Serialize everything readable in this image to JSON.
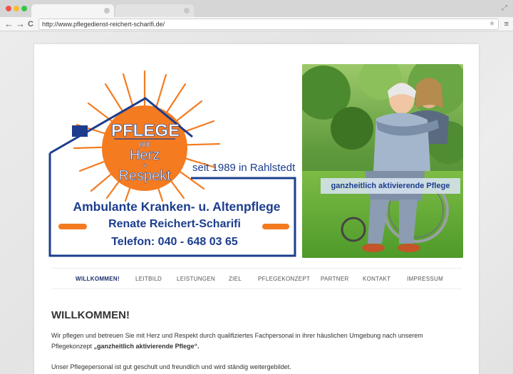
{
  "browser": {
    "url": "http://www.pflegedienst-reichert-scharifi.de/",
    "back_glyph": "←",
    "forward_glyph": "→",
    "reload_glyph": "C",
    "star_glyph": "★",
    "menu_glyph": "≡",
    "resize_glyph": "⤢"
  },
  "logo": {
    "pflege": "PFLEGE",
    "mit": "mit",
    "herz": "Herz",
    "plus": "+",
    "respekt": "Respekt",
    "since": "seit 1989 in Rahlstedt",
    "service": "Ambulante Kranken- u. Altenpflege",
    "owner": "Renate Reichert-Scharifi",
    "phone": "Telefon: 040 - 648 03 65"
  },
  "photo": {
    "caption": "ganzheitlich aktivierende Pflege"
  },
  "nav": {
    "items": [
      {
        "label": "WILLKOMMEN!",
        "active": true
      },
      {
        "label": "LEITBILD",
        "active": false
      },
      {
        "label": "LEISTUNGEN",
        "active": false
      },
      {
        "label": "ZIEL",
        "active": false
      },
      {
        "label": "PFLEGEKONZEPT",
        "active": false
      },
      {
        "label": "PARTNER",
        "active": false
      },
      {
        "label": "KONTAKT",
        "active": false
      },
      {
        "label": "IMPRESSUM",
        "active": false
      }
    ]
  },
  "content": {
    "title": "WILLKOMMEN!",
    "para1_text": "Wir pflegen und betreuen Sie mit Herz und Respekt durch qualifiziertes Fachpersonal in ihrer häuslichen Umgebung nach unserem Pflegekonzept ",
    "para1_bold": "„ganzheitlich aktivierende Pflege“.",
    "para2": "Unser Pflegepersonal ist gut geschult und freundlich und wird ständig weitergebildet."
  },
  "colors": {
    "brand_blue": "#1c3d8e",
    "sun_orange": "#f47b20"
  }
}
